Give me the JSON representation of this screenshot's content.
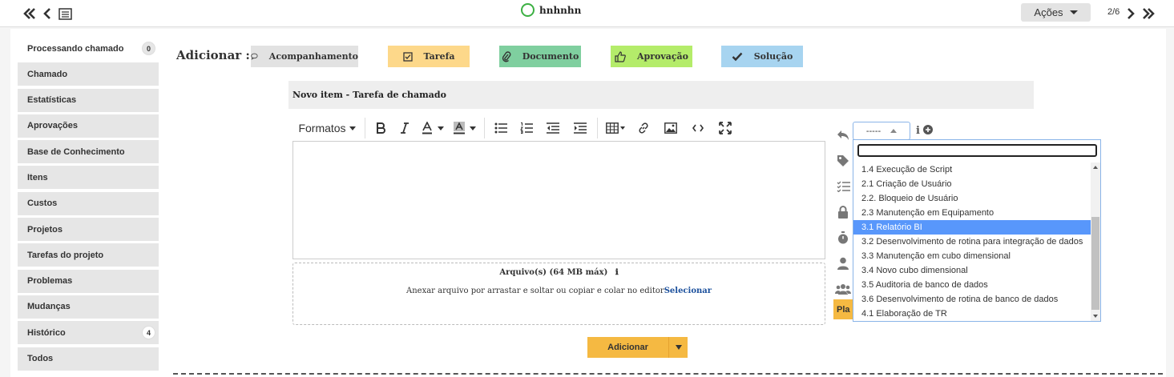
{
  "topbar": {
    "ticket_name": "hnhnhn",
    "actions_label": "Ações",
    "pager": "2/6"
  },
  "sidebar": {
    "items": [
      {
        "label": "Processando chamado",
        "badge": "0"
      },
      {
        "label": "Chamado"
      },
      {
        "label": "Estatísticas"
      },
      {
        "label": "Aprovações"
      },
      {
        "label": "Base de Conhecimento"
      },
      {
        "label": "Itens"
      },
      {
        "label": "Custos"
      },
      {
        "label": "Projetos"
      },
      {
        "label": "Tarefas do projeto"
      },
      {
        "label": "Problemas"
      },
      {
        "label": "Mudanças"
      },
      {
        "label": "Histórico",
        "badge": "4"
      },
      {
        "label": "Todos"
      }
    ]
  },
  "add_bar": {
    "label": "Adicionar :",
    "buttons": [
      {
        "label": "Acompanhamento",
        "icon": "speech-bubble-icon",
        "color": "#e2e2e2"
      },
      {
        "label": "Tarefa",
        "icon": "checkbox-icon",
        "color": "#fdd88a"
      },
      {
        "label": "Documento",
        "icon": "paperclip-icon",
        "color": "#7fcf9f"
      },
      {
        "label": "Aprovação",
        "icon": "thumbs-up-icon",
        "color": "#b4ec6a"
      },
      {
        "label": "Solução",
        "icon": "check-icon",
        "color": "#a7d4f0"
      }
    ]
  },
  "form": {
    "header": "Novo item - Tarefa de chamado",
    "toolbar": {
      "formats_label": "Formatos"
    },
    "attachment": {
      "title": "Arquivo(s) (64 MB máx)",
      "text": "Anexar arquivo por arrastar e soltar ou copiar e colar no editor",
      "link": "Selecionar"
    },
    "select_value": "-----",
    "plan_label": "Pla",
    "submit_label": "Adicionar"
  },
  "dropdown": {
    "search_value": "",
    "options": [
      "1.4 Execução de Script",
      "2.1 Criação de Usuário",
      "2.2. Bloqueio de Usuário",
      "2.3 Manutenção em Equipamento",
      "3.1 Relatório BI",
      "3.2 Desenvolvimento de rotina para integração de dados",
      "3.3 Manutenção em cubo dimensional",
      "3.4 Novo cubo dimensional",
      "3.5 Auditoria de banco de dados",
      "3.6 Desenvolvimento de rotina de banco de dados",
      "4.1 Elaboração de TR"
    ],
    "selected": "3.1 Relatório BI"
  }
}
